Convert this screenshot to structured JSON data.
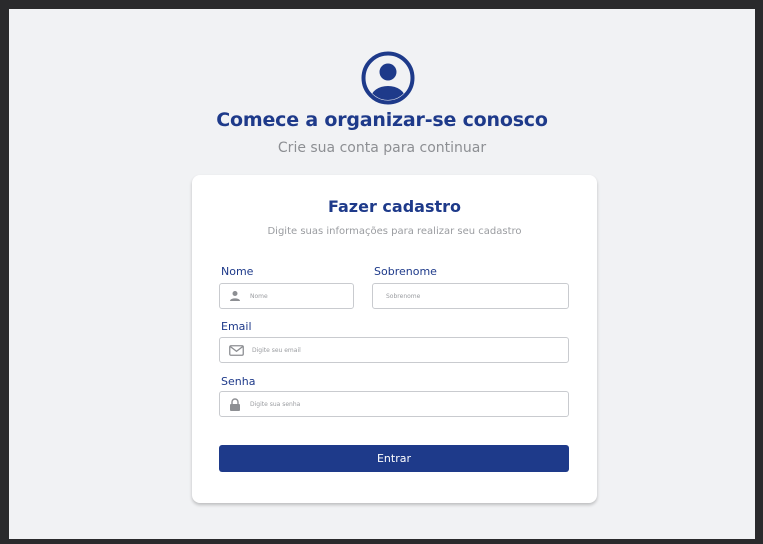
{
  "header": {
    "avatar_icon": "user-circle-icon",
    "headline": "Comece a organizar-se conosco",
    "subline": "Crie sua conta para continuar"
  },
  "form": {
    "title": "Fazer cadastro",
    "description": "Digite suas informações para realizar seu cadastro",
    "fields": {
      "nome": {
        "label": "Nome",
        "placeholder": "Nome",
        "value": "",
        "icon": "user-icon"
      },
      "sobrenome": {
        "label": "Sobrenome",
        "placeholder": "Sobrenome",
        "value": ""
      },
      "email": {
        "label": "Email",
        "placeholder": "Digite seu email",
        "value": "",
        "icon": "mail-icon"
      },
      "senha": {
        "label": "Senha",
        "placeholder": "Digite sua senha",
        "value": "",
        "icon": "lock-icon"
      }
    },
    "submit_label": "Entrar"
  },
  "colors": {
    "primary": "#1e3a8a",
    "background": "#f1f2f4",
    "card": "#ffffff",
    "muted_text": "#8d8f93"
  }
}
